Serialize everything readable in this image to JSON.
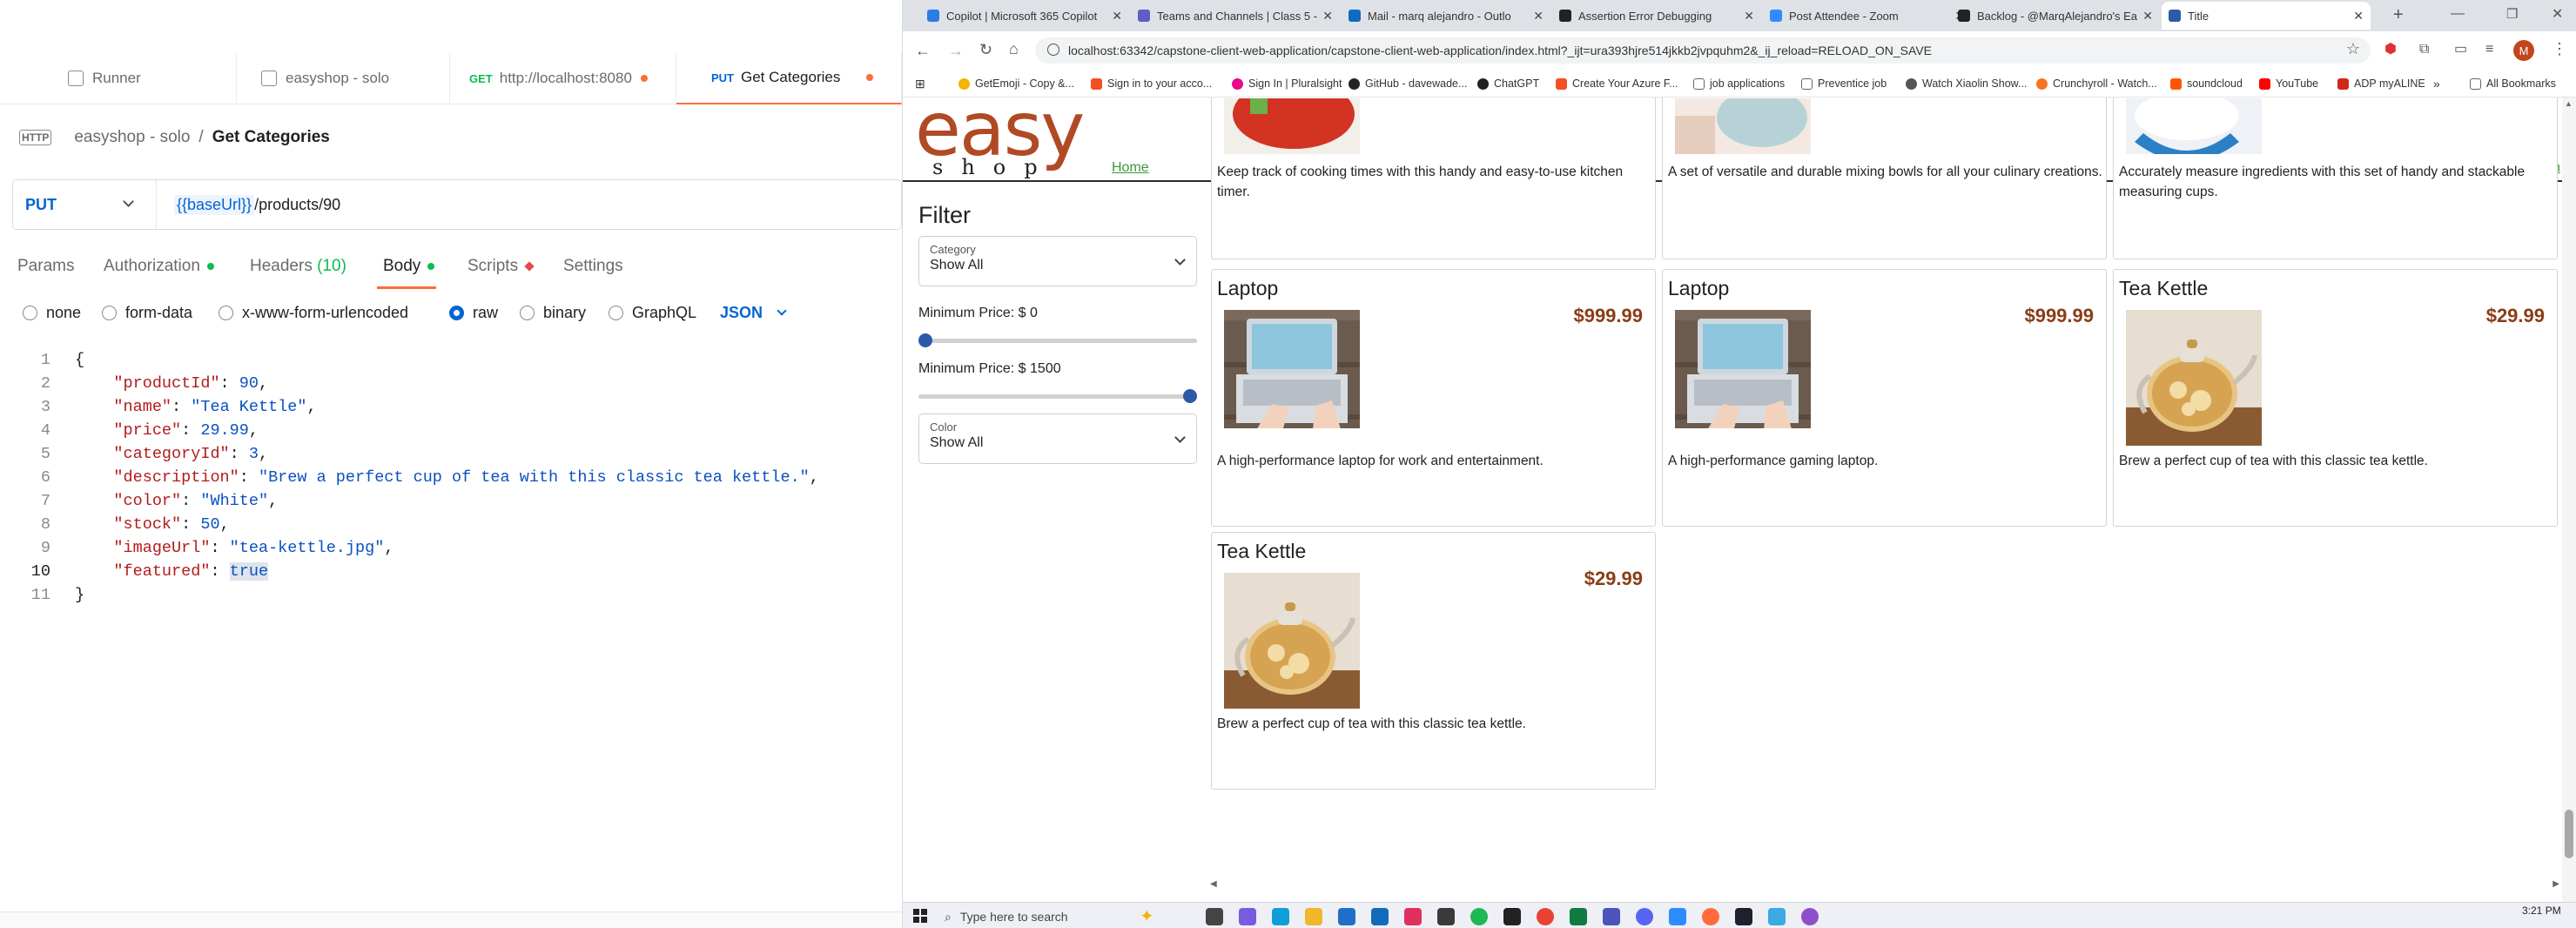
{
  "postman": {
    "tabs": [
      {
        "label": "Runner"
      },
      {
        "label": "easyshop - solo"
      },
      {
        "method": "GET",
        "label": "http://localhost:8080"
      },
      {
        "method": "PUT",
        "label": "Get Categories"
      }
    ],
    "breadcrumb": {
      "collection": "easyshop - solo",
      "separator": "/",
      "request": "Get Categories"
    },
    "request": {
      "method": "PUT",
      "url_var": "{{baseUrl}}",
      "url_path": " /products/90"
    },
    "req_tabs": [
      {
        "label": "Params"
      },
      {
        "label": "Authorization"
      },
      {
        "label": "Headers",
        "count": "(10)"
      },
      {
        "label": "Body"
      },
      {
        "label": "Scripts"
      },
      {
        "label": "Settings"
      }
    ],
    "body_options": [
      "none",
      "form-data",
      "x-www-form-urlencoded",
      "raw",
      "binary",
      "GraphQL"
    ],
    "body_format": "JSON",
    "editor": {
      "line_numbers": [
        "1",
        "2",
        "3",
        "4",
        "5",
        "6",
        "7",
        "8",
        "9",
        "10",
        "11"
      ],
      "lines": {
        "l1": "{",
        "l2_key": "\"productId\"",
        "l2_val": "90",
        "l3_key": "\"name\"",
        "l3_val": "\"Tea Kettle\"",
        "l4_key": "\"price\"",
        "l4_val": "29.99",
        "l5_key": "\"categoryId\"",
        "l5_val": "3",
        "l6_key": "\"description\"",
        "l6_val": "\"Brew a perfect cup of tea with this classic tea kettle.\"",
        "l7_key": "\"color\"",
        "l7_val": "\"White\"",
        "l8_key": "\"stock\"",
        "l8_val": "50",
        "l9_key": "\"imageUrl\"",
        "l9_val": "\"tea-kettle.jpg\"",
        "l10_key": "\"featured\"",
        "l10_val": "true",
        "l11": "}"
      }
    }
  },
  "browser": {
    "tabs": [
      {
        "label": "Copilot | Microsoft 365 Copilot",
        "color": "#2a7de1"
      },
      {
        "label": "Teams and Channels | Class 5 -",
        "color": "#5b5fc7"
      },
      {
        "label": "Mail - marq alejandro - Outlo",
        "color": "#0f6cbd"
      },
      {
        "label": "Assertion Error Debugging",
        "color": "#222222"
      },
      {
        "label": "Post Attendee - Zoom",
        "color": "#2d8cff"
      },
      {
        "label": "Backlog - @MarqAlejandro's Ea",
        "color": "#222222"
      },
      {
        "label": "Title",
        "color": "#2d5aa8"
      }
    ],
    "address": "localhost:63342/capstone-client-web-application/capstone-client-web-application/index.html?_ijt=ura393hjre514jkkb2jvpquhm2&_ij_reload=RELOAD_ON_SAVE",
    "bookmarks": [
      {
        "label": "GetEmoji - Copy &...",
        "color": "#f4b400"
      },
      {
        "label": "Sign in to your acco...",
        "color": "#f25022"
      },
      {
        "label": "Sign In | Pluralsight",
        "color": "#e80a89"
      },
      {
        "label": "GitHub - davewade...",
        "color": "#222222"
      },
      {
        "label": "ChatGPT",
        "color": "#222222"
      },
      {
        "label": "Create Your Azure F...",
        "color": "#f25022"
      },
      {
        "label": "job applications",
        "color": "#888888"
      },
      {
        "label": "Preventice job",
        "color": "#888888"
      },
      {
        "label": "Watch Xiaolin Show...",
        "color": "#555555"
      },
      {
        "label": "Crunchyroll - Watch...",
        "color": "#f47521"
      },
      {
        "label": "soundcloud",
        "color": "#ff5500"
      },
      {
        "label": "YouTube",
        "color": "#ff0000"
      },
      {
        "label": "ADP myALINE",
        "color": "#d0271d"
      },
      {
        "label": "All Bookmarks",
        "color": "#888888"
      }
    ],
    "profile_initial": "M"
  },
  "site": {
    "logo_top": "easy",
    "logo_bottom": "shop",
    "home": "Home",
    "login": "login",
    "filter": {
      "title": "Filter",
      "category_label": "Category",
      "category_value": "Show All",
      "min_price_label": "Minimum Price: $ 0",
      "max_price_label": "Minimum Price: $ 1500",
      "color_label": "Color",
      "color_value": "Show All",
      "min_slider_fraction": 0,
      "max_slider_fraction": 1
    },
    "products_partial": [
      {
        "description": "Keep track of cooking times with this handy and easy-to-use kitchen timer."
      },
      {
        "description": "A set of versatile and durable mixing bowls for all your culinary creations."
      },
      {
        "description": "Accurately measure ingredients with this set of handy and stackable measuring cups."
      }
    ],
    "products": [
      {
        "name": "Laptop",
        "price": "$999.99",
        "description": "A high-performance laptop for work and entertainment."
      },
      {
        "name": "Laptop",
        "price": "$999.99",
        "description": "A high-performance gaming laptop."
      },
      {
        "name": "Tea Kettle",
        "price": "$29.99",
        "description": "Brew a perfect cup of tea with this classic tea kettle."
      },
      {
        "name": "Tea Kettle",
        "price": "$29.99",
        "description": "Brew a perfect cup of tea with this classic tea kettle."
      }
    ]
  },
  "taskbar": {
    "search_placeholder": "Type here to search",
    "time": "3:21 PM"
  }
}
